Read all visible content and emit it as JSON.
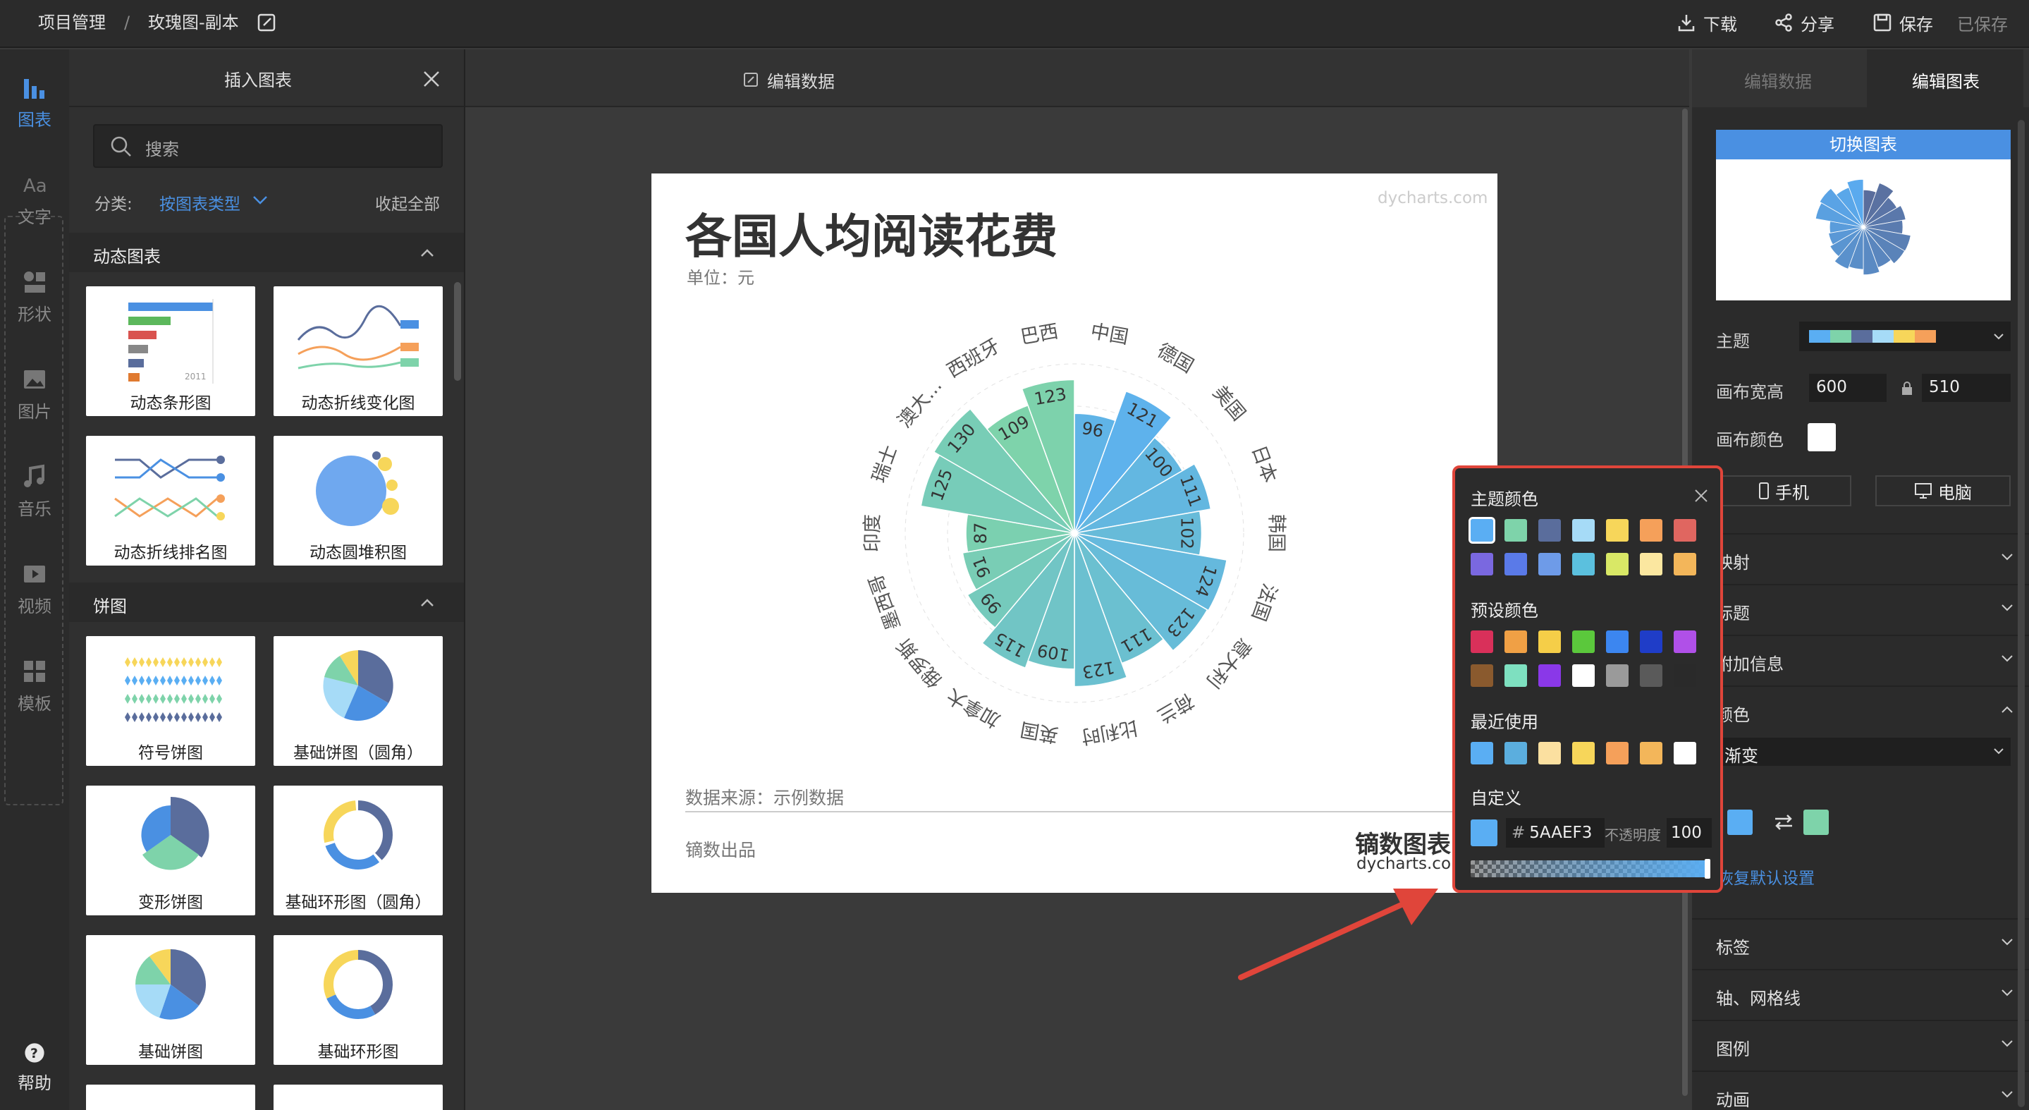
{
  "topbar": {
    "crumb_root": "项目管理",
    "crumb_sep": "/",
    "crumb_current": "玫瑰图-副本",
    "download": "下载",
    "share": "分享",
    "save": "保存",
    "saved_status": "已保存"
  },
  "rail": {
    "items": [
      {
        "label": "图表",
        "icon": "bar-chart-icon",
        "active": true
      },
      {
        "label": "文字",
        "icon": "text-icon"
      },
      {
        "label": "形状",
        "icon": "shape-icon"
      },
      {
        "label": "图片",
        "icon": "image-icon"
      },
      {
        "label": "音乐",
        "icon": "music-icon"
      },
      {
        "label": "视频",
        "icon": "video-icon"
      },
      {
        "label": "模板",
        "icon": "template-icon"
      }
    ],
    "help": "帮助"
  },
  "panel": {
    "title": "插入图表",
    "search_placeholder": "搜索",
    "category_label": "分类:",
    "category_value": "按图表类型",
    "collapse_all": "收起全部",
    "sections": [
      {
        "title": "动态图表",
        "cards": [
          "动态条形图",
          "动态折线变化图",
          "动态折线排名图",
          "动态圆堆积图"
        ]
      },
      {
        "title": "饼图",
        "cards": [
          "符号饼图",
          "基础饼图（圆角）",
          "变形饼图",
          "基础环形图（圆角）",
          "基础饼图",
          "基础环形图"
        ]
      }
    ],
    "thumb_year": "2011"
  },
  "center": {
    "edit_data": "编辑数据"
  },
  "chart": {
    "title": "各国人均阅读花费",
    "unit": "单位：元",
    "source": "数据来源：示例数据",
    "footer": "镝数出品",
    "watermark": "dycharts.com",
    "logo_cn": "镝数图表",
    "logo_en": "dycharts.com"
  },
  "chart_data": {
    "type": "rose",
    "categories": [
      "中国",
      "德国",
      "美国",
      "日本",
      "韩国",
      "法国",
      "意大利",
      "荷兰",
      "比利时",
      "英国",
      "加拿大",
      "俄罗斯",
      "墨西哥",
      "印度",
      "瑞士",
      "澳大...",
      "西班牙",
      "巴西"
    ],
    "values": [
      96,
      121,
      100,
      111,
      102,
      124,
      123,
      111,
      123,
      109,
      115,
      99,
      91,
      87,
      125,
      130,
      109,
      123
    ],
    "color_range": [
      "#5AAEF3",
      "#7ED3AA"
    ]
  },
  "rpanel": {
    "tab_data": "编辑数据",
    "tab_chart": "编辑图表",
    "switch_chart": "切换图表",
    "theme_label": "主题",
    "theme_colors": [
      "#5AAEF3",
      "#7ED3AA",
      "#5A6D9C",
      "#A6DBF7",
      "#F7D65A",
      "#F5A05A"
    ],
    "canvas_size_label": "画布宽高",
    "canvas_width": "600",
    "canvas_height": "510",
    "canvas_color_label": "画布颜色",
    "phone": "手机",
    "desktop": "电脑",
    "rows": [
      "映射",
      "标题",
      "附加信息",
      "颜色"
    ],
    "gradient": "渐变",
    "reset": "恢复默认设置",
    "rows2": [
      "标签",
      "轴、网格线",
      "图例",
      "动画"
    ],
    "gradient_colors": [
      "#5AAEF3",
      "#7ED3AA"
    ]
  },
  "popup": {
    "theme_title": "主题颜色",
    "theme_colors": [
      "#5AAEF3",
      "#7ED3AA",
      "#5A6D9C",
      "#A6DBF7",
      "#F7D65A",
      "#F5A05A",
      "#E06660",
      "#7A68E0",
      "#5A7AE8",
      "#6E9BE8",
      "#5BC0DE",
      "#D9E866",
      "#FBE7A0",
      "#F3B65A"
    ],
    "preset_title": "预设颜色",
    "preset_colors": [
      "#D9305A",
      "#F0A045",
      "#F5CE48",
      "#5BC83C",
      "#3C86F0",
      "#1F3DC8",
      "#B050E8",
      "#8A5A2E",
      "#7EE0C0",
      "#8A38E8",
      "#FFFFFF",
      "#9A9A9A",
      "#5A5A5A",
      "#2A2A2A"
    ],
    "recent_title": "最近使用",
    "recent_colors": [
      "#5AAEF3",
      "#5BAEDE",
      "#FBE0A0",
      "#F7D65A",
      "#F5A05A",
      "#F3B65A",
      "#FFFFFF"
    ],
    "custom_title": "自定义",
    "hex_prefix": "#",
    "hex_value": "5AAEF3",
    "opacity_label": "不透明度",
    "opacity_value": "100"
  }
}
